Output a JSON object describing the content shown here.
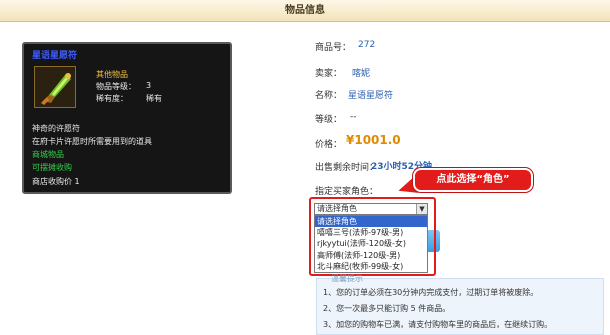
{
  "header": {
    "title": "物品信息"
  },
  "item_card": {
    "name": "星语星愿符",
    "icon": "talisman-item-icon",
    "type": "其他物品",
    "level_label": "物品等级：",
    "level_value": "3",
    "rarity_label": "稀有度：",
    "rarity_value": "稀有",
    "title": "神奇的许愿符",
    "description": "在府卡片许愿时所需要用到的道具",
    "mall_tag": "商城物品",
    "tradable_tag": "可摆摊收购",
    "shop_price": "商店收购价 1"
  },
  "info": {
    "product_no_label": "商品号：",
    "product_no": "272",
    "seller_label": "卖家：",
    "seller": "喀妮",
    "name_label": "名称：",
    "name": "星语星愿符",
    "level_label": "等级：",
    "level": "--",
    "price_label": "价格：",
    "price": "¥1001.0",
    "time_label": "出售剩余时间：",
    "time": "23小时52分钟",
    "buyer_label": "指定买家角色："
  },
  "callout": {
    "text": "点此选择“角色”"
  },
  "role_select": {
    "selected": "请选择角色",
    "options": [
      "请选择角色",
      "嘻嘻三号(法师-97级-男)",
      "rjkyytui(法师-120级-女)",
      "高师傅(法师-120级-男)",
      "北斗麻纪(牧师-99级-女)"
    ]
  },
  "notice": {
    "heading": "温馨提示",
    "lines": [
      "1、您的订单必须在30分钟内完成支付，过期订单将被废除。",
      "2、您一次最多只能订购 5 件商品。",
      "3、加您的购物车已满，请支付购物车里的商品后，在继续订购。"
    ]
  },
  "colors": {
    "accent_red": "#e21b1b",
    "link_blue": "#2a5fb0",
    "price_orange": "#e08a00",
    "tag_green": "#34d04a"
  }
}
